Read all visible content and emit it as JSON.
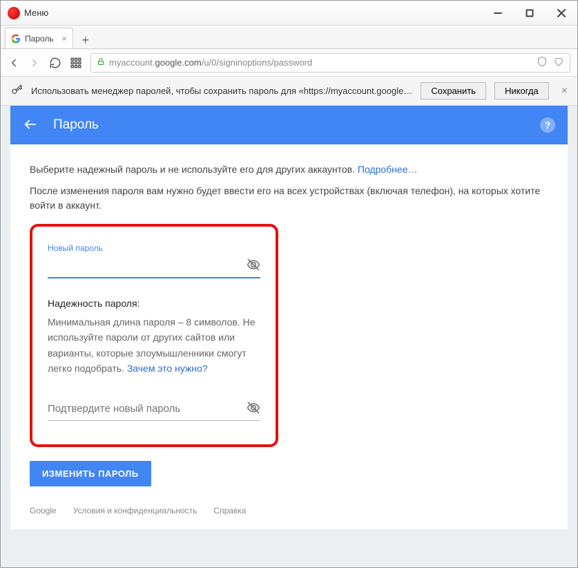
{
  "titlebar": {
    "menu_label": "Меню"
  },
  "tab": {
    "title": "Пароль"
  },
  "address": {
    "host": "myaccount.google.com",
    "path": "/u/0/signinoptions/password"
  },
  "infobar": {
    "text": "Использовать менеджер паролей, чтобы сохранить пароль для «https://myaccount.google.c…",
    "save": "Сохранить",
    "never": "Никогда"
  },
  "header": {
    "title": "Пароль"
  },
  "intro": {
    "line1_a": "Выберите надежный пароль и не используйте его для других аккаунтов. ",
    "learn_more": "Подробнее…",
    "line2": "После изменения пароля вам нужно будет ввести его на всех устройствах (включая телефон), на которых хотите войти в аккаунт."
  },
  "form": {
    "new_password_label": "Новый пароль",
    "strength_title": "Надежность пароля:",
    "strength_text_a": "Минимальная длина пароля – 8 символов. Не используйте пароли от других сайтов или варианты, которые злоумышленники смогут легко подобрать. ",
    "why_link": "Зачем это нужно?",
    "confirm_placeholder": "Подтвердите новый пароль",
    "submit": "ИЗМЕНИТЬ ПАРОЛЬ"
  },
  "footer": {
    "google": "Google",
    "terms": "Условия и конфиденциальность",
    "help": "Справка"
  }
}
